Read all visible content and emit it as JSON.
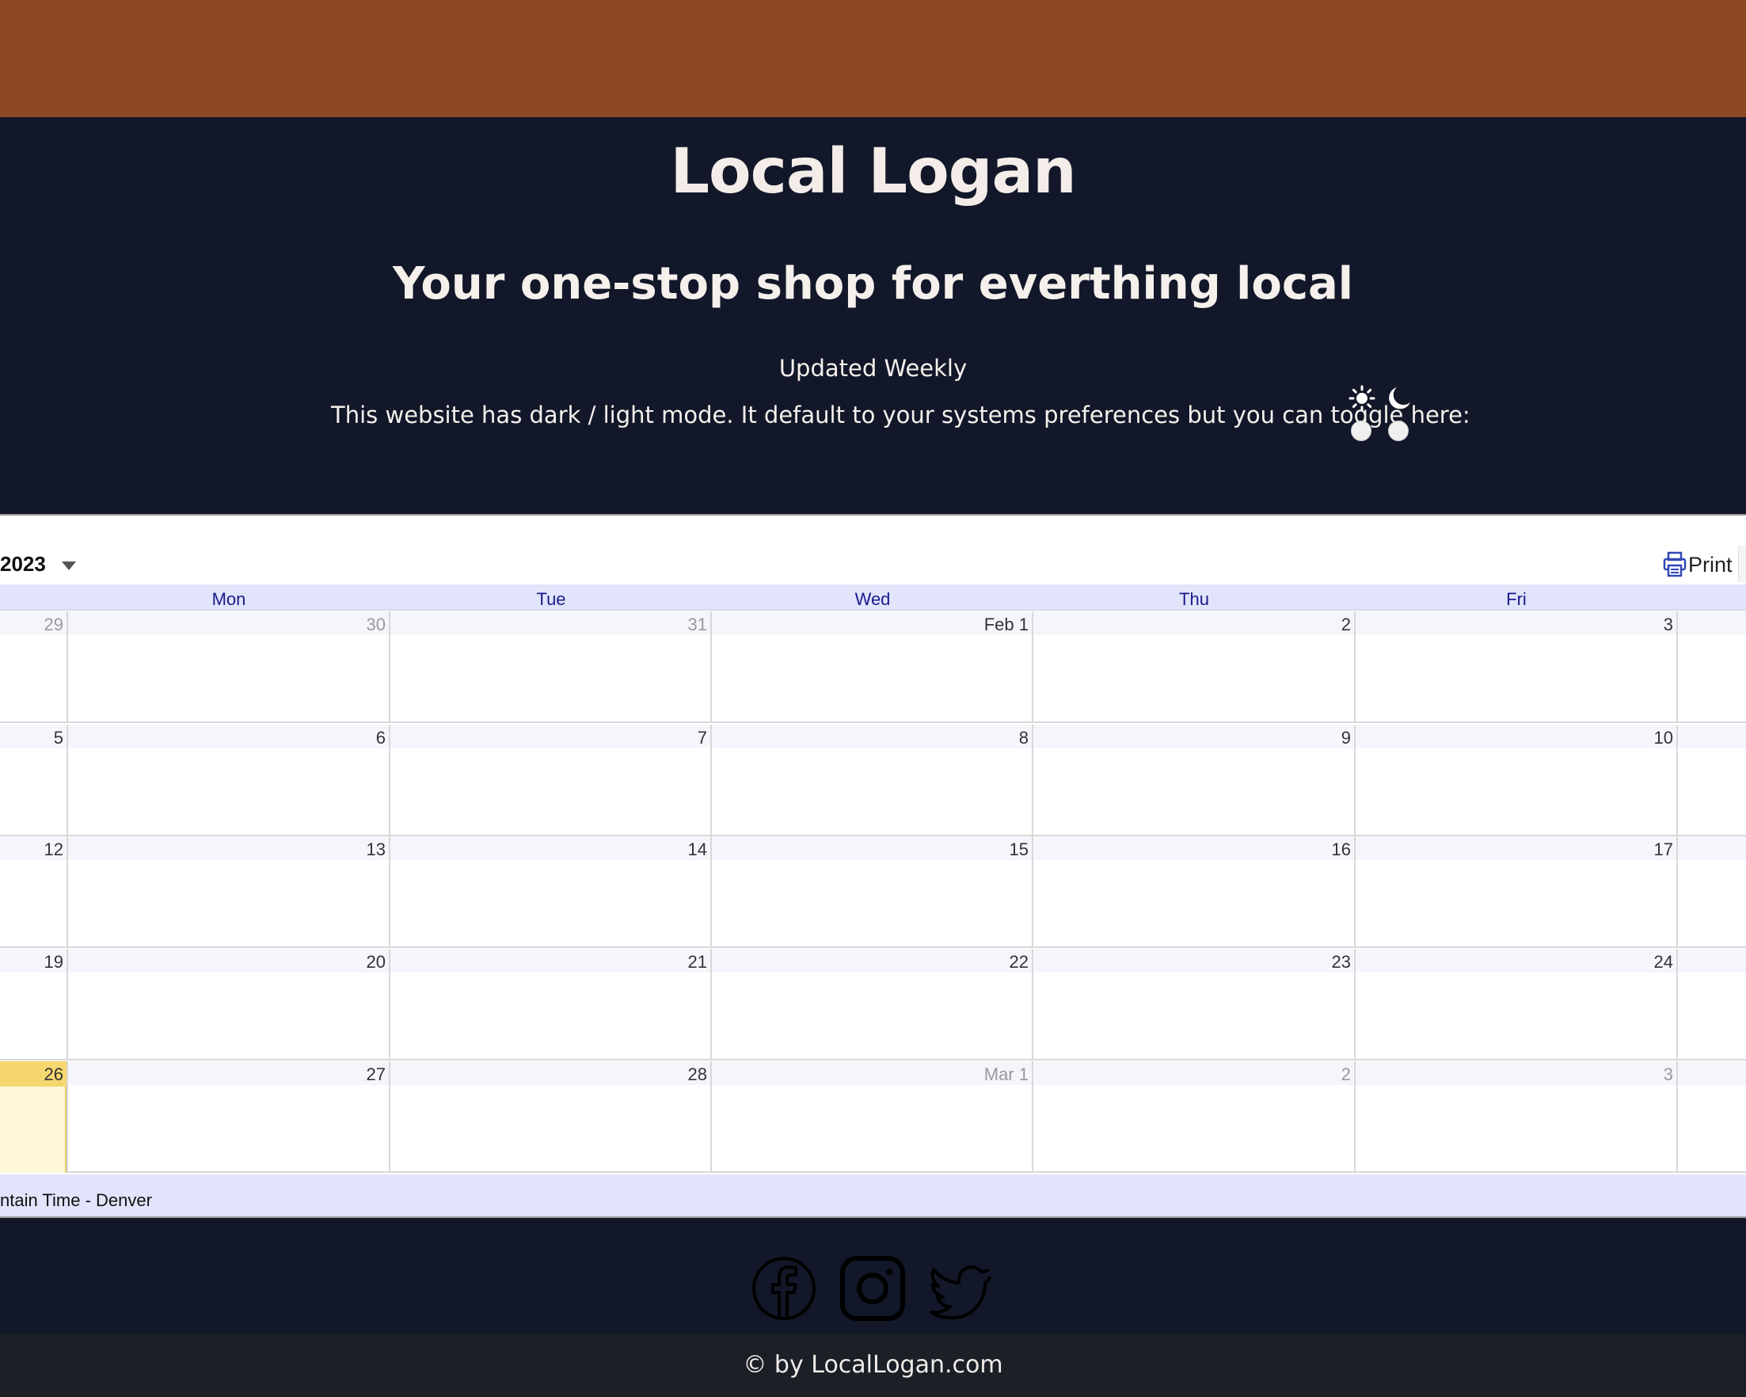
{
  "header": {
    "title": "Local Logan",
    "tagline": "Your one-stop shop for everthing local",
    "updated": "Updated Weekly",
    "mode_text": "This website has dark / light mode. It default to your systems preferences but you can toggle here:",
    "toggle_icons": [
      "sun-icon",
      "moon-icon"
    ]
  },
  "calendar": {
    "month_label": "2023",
    "print_label": "Print",
    "day_names": [
      "Mon",
      "Tue",
      "Wed",
      "Thu",
      "Fri"
    ],
    "weeks": [
      [
        {
          "d": "29",
          "muted": true
        },
        {
          "d": "30",
          "muted": true
        },
        {
          "d": "31",
          "muted": true
        },
        {
          "d": "Feb 1"
        },
        {
          "d": "2"
        },
        {
          "d": "3"
        }
      ],
      [
        {
          "d": "5"
        },
        {
          "d": "6"
        },
        {
          "d": "7"
        },
        {
          "d": "8"
        },
        {
          "d": "9"
        },
        {
          "d": "10"
        }
      ],
      [
        {
          "d": "12"
        },
        {
          "d": "13"
        },
        {
          "d": "14"
        },
        {
          "d": "15"
        },
        {
          "d": "16"
        },
        {
          "d": "17"
        }
      ],
      [
        {
          "d": "19"
        },
        {
          "d": "20"
        },
        {
          "d": "21"
        },
        {
          "d": "22"
        },
        {
          "d": "23"
        },
        {
          "d": "24"
        }
      ],
      [
        {
          "d": "26",
          "today": true
        },
        {
          "d": "27"
        },
        {
          "d": "28"
        },
        {
          "d": "Mar 1",
          "muted": true
        },
        {
          "d": "2",
          "muted": true
        },
        {
          "d": "3",
          "muted": true
        }
      ]
    ],
    "timezone": "ntain Time - Denver"
  },
  "social": {
    "icons": [
      "facebook-icon",
      "instagram-icon",
      "twitter-icon"
    ]
  },
  "footer": {
    "copyright": "© by LocalLogan.com"
  },
  "colors": {
    "topbar": "#8b4823",
    "dark_bg": "#121829",
    "footer_bg": "#1b2027",
    "calendar_header": "#e1e4fa",
    "today_highlight": "#f6d66f"
  }
}
